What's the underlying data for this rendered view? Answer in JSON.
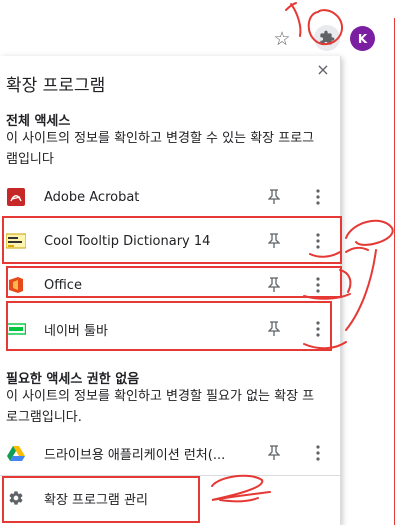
{
  "popup": {
    "title": "확장 프로그램",
    "close_glyph": "×",
    "full_access": {
      "heading": "전체 액세스",
      "description": "이 사이트의 정보를 확인하고 변경할 수 있는 확장 프로그램입니다"
    },
    "no_access": {
      "heading": "필요한 액세스 권한 없음",
      "description": "이 사이트의 정보를 확인하고 변경할 필요가 없는 확장 프로그램입니다."
    },
    "extensions_full": [
      {
        "name": "Adobe Acrobat",
        "icon": "adobe-acrobat-icon"
      },
      {
        "name": "Cool Tooltip Dictionary 14",
        "icon": "dictionary-icon"
      },
      {
        "name": "Office",
        "icon": "office-icon"
      },
      {
        "name": "네이버 툴바",
        "icon": "naver-toolbar-icon"
      }
    ],
    "extensions_none": [
      {
        "name": "드라이브용 애플리케이션 런처(...",
        "icon": "google-drive-icon"
      }
    ],
    "manage_label": "확장 프로그램 관리"
  },
  "toolbar": {
    "avatar_letter": "K"
  },
  "colors": {
    "annotation": "#e53935",
    "avatar": "#7b1fa2"
  }
}
